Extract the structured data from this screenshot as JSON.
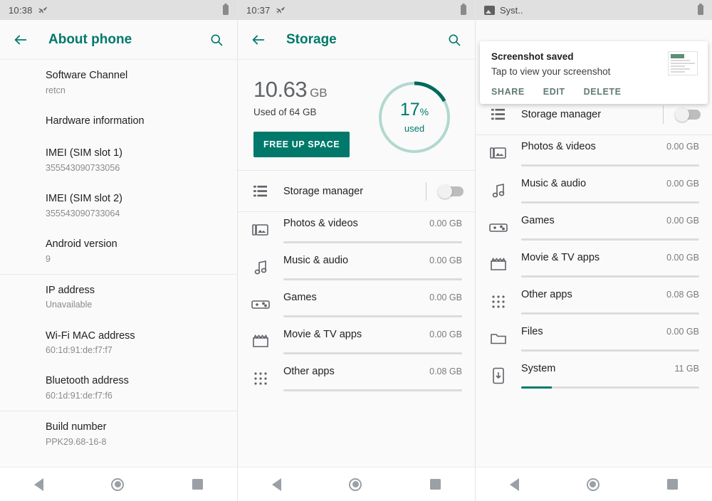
{
  "panels": {
    "about": {
      "status_bar": {
        "time": "10:38",
        "airplane_icon": "airplane-mode-icon",
        "battery_icon": "battery-icon"
      },
      "app_bar": {
        "back_icon": "back-arrow-icon",
        "title": "About phone",
        "search_icon": "search-icon"
      },
      "items": [
        {
          "title": "Software Channel",
          "sub": "retcn",
          "divider_before": false
        },
        {
          "title": "Hardware information",
          "sub": "",
          "divider_before": false
        },
        {
          "title": "IMEI (SIM slot 1)",
          "sub": "355543090733056",
          "divider_before": false
        },
        {
          "title": "IMEI (SIM slot 2)",
          "sub": "355543090733064",
          "divider_before": false
        },
        {
          "title": "Android version",
          "sub": "9",
          "divider_before": false
        },
        {
          "title": "IP address",
          "sub": "Unavailable",
          "divider_before": true
        },
        {
          "title": "Wi-Fi MAC address",
          "sub": "60:1d:91:de:f7:f7",
          "divider_before": false
        },
        {
          "title": "Bluetooth address",
          "sub": "60:1d:91:de:f7:f6",
          "divider_before": false
        },
        {
          "title": "Build number",
          "sub": "PPK29.68-16-8",
          "divider_before": true
        }
      ]
    },
    "storage": {
      "status_bar": {
        "time": "10:37",
        "airplane_icon": "airplane-mode-icon",
        "battery_icon": "battery-icon"
      },
      "app_bar": {
        "back_icon": "back-arrow-icon",
        "title": "Storage",
        "search_icon": "search-icon"
      },
      "summary": {
        "amount": "10.63",
        "unit": "GB",
        "used_of": "Used of 64 GB",
        "free_button": "FREE UP SPACE",
        "donut_percent": "17",
        "donut_percent_symbol": "%",
        "donut_caption": "used"
      },
      "manager": {
        "icon": "storage-manager-icon",
        "label": "Storage manager",
        "toggle_state": "off"
      },
      "categories": [
        {
          "icon": "photos-videos-icon",
          "name": "Photos & videos",
          "size": "0.00 GB",
          "fill_pct": 0
        },
        {
          "icon": "music-audio-icon",
          "name": "Music & audio",
          "size": "0.00 GB",
          "fill_pct": 0
        },
        {
          "icon": "games-icon",
          "name": "Games",
          "size": "0.00 GB",
          "fill_pct": 0
        },
        {
          "icon": "movie-tv-apps-icon",
          "name": "Movie & TV apps",
          "size": "0.00 GB",
          "fill_pct": 0
        },
        {
          "icon": "other-apps-icon",
          "name": "Other apps",
          "size": "0.08 GB",
          "fill_pct": 0
        }
      ]
    },
    "notification_panel": {
      "status_bar": {
        "app_icon": "image-notification-icon",
        "label": "Syst..",
        "battery_icon": "battery-icon"
      },
      "notification": {
        "title": "Screenshot saved",
        "subtitle": "Tap to view your screenshot",
        "thumbnail_icon": "screenshot-thumbnail",
        "actions": [
          "SHARE",
          "EDIT",
          "DELETE"
        ]
      },
      "manager": {
        "icon": "storage-manager-icon",
        "label": "Storage manager",
        "toggle_state": "off"
      },
      "categories": [
        {
          "icon": "photos-videos-icon",
          "name": "Photos & videos",
          "size": "0.00 GB",
          "fill_pct": 0
        },
        {
          "icon": "music-audio-icon",
          "name": "Music & audio",
          "size": "0.00 GB",
          "fill_pct": 0
        },
        {
          "icon": "games-icon",
          "name": "Games",
          "size": "0.00 GB",
          "fill_pct": 0
        },
        {
          "icon": "movie-tv-apps-icon",
          "name": "Movie & TV apps",
          "size": "0.00 GB",
          "fill_pct": 0
        },
        {
          "icon": "other-apps-icon",
          "name": "Other apps",
          "size": "0.08 GB",
          "fill_pct": 0
        },
        {
          "icon": "files-icon",
          "name": "Files",
          "size": "0.00 GB",
          "fill_pct": 0
        },
        {
          "icon": "system-icon",
          "name": "System",
          "size": "11 GB",
          "fill_pct": 17
        }
      ]
    }
  },
  "nav_bar": {
    "back_icon": "nav-back-icon",
    "home_icon": "nav-home-icon",
    "recents_icon": "nav-recents-icon"
  },
  "colors": {
    "accent": "#00796b",
    "donut_track": "#b2d8d0",
    "status_bar_bg": "#e0e0e0",
    "panel_bg": "#fafafa",
    "text_primary": "#202124",
    "text_secondary": "#8b8b8b"
  }
}
